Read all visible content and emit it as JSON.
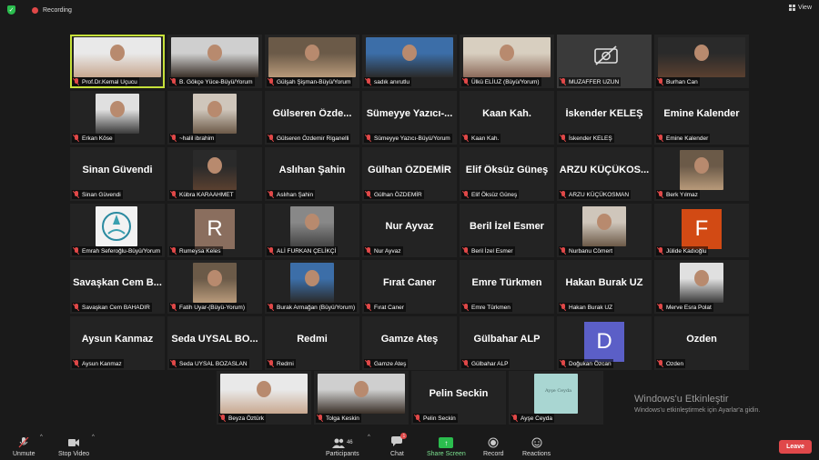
{
  "app": {
    "recording_label": "Recording",
    "view_label": "View"
  },
  "colors": {
    "active_border": "#c6e03a",
    "mute_red": "#e04848",
    "share_green": "#2bbd4e",
    "leave_red": "#e0484a"
  },
  "participants": [
    {
      "label": "Prof.Dr.Kemal Uçucu",
      "display": "",
      "type": "photo",
      "active": true
    },
    {
      "label": "B. Gökçe Yüce-Büyü/Yorum",
      "display": "",
      "type": "photo"
    },
    {
      "label": "Gülşah Şişman-Büyü/Yorum",
      "display": "",
      "type": "photo"
    },
    {
      "label": "sadık anırutlu",
      "display": "",
      "type": "photo"
    },
    {
      "label": "Ülkü ELİUZ (Büyü/Yorum)",
      "display": "",
      "type": "photo"
    },
    {
      "label": "MUZAFFER UZUN",
      "display": "",
      "type": "camoff"
    },
    {
      "label": "Burhan Can",
      "display": "",
      "type": "photo"
    },
    {
      "label": "Erkan Köse",
      "display": "",
      "type": "photo"
    },
    {
      "label": "~halil ibrahim",
      "display": "",
      "type": "photo"
    },
    {
      "label": "Gülseren Özdemir Riganelli",
      "display": "Gülseren Özde...",
      "type": "name"
    },
    {
      "label": "Sümeyye Yazıcı-Büyü/Yorum",
      "display": "Sümeyye Yazıcı-...",
      "type": "name"
    },
    {
      "label": "Kaan Kah.",
      "display": "Kaan Kah.",
      "type": "name"
    },
    {
      "label": "İskender KELEŞ",
      "display": "İskender KELEŞ",
      "type": "name"
    },
    {
      "label": "Emine Kalender",
      "display": "Emine Kalender",
      "type": "name"
    },
    {
      "label": "Sinan Güvendi",
      "display": "Sinan Güvendi",
      "type": "name"
    },
    {
      "label": "Kübra KARAAHMET",
      "display": "",
      "type": "photo"
    },
    {
      "label": "Aslıhan Şahin",
      "display": "Aslıhan Şahin",
      "type": "name"
    },
    {
      "label": "Gülhan ÖZDEMİR",
      "display": "Gülhan ÖZDEMİR",
      "type": "name"
    },
    {
      "label": "Elif Öksüz Güneş",
      "display": "Elif Öksüz Güneş",
      "type": "name"
    },
    {
      "label": "ARZU KÜÇÜKOSMAN",
      "display": "ARZU KÜÇÜKOS...",
      "type": "name"
    },
    {
      "label": "Berk Yılmaz",
      "display": "",
      "type": "photo"
    },
    {
      "label": "Emrah Seferoğlu-Büyü/Yorum",
      "display": "",
      "type": "logo"
    },
    {
      "label": "Rumeysa Keles",
      "display": "R",
      "type": "letter",
      "color": "#8a6e5e"
    },
    {
      "label": "ALİ FURKAN ÇELİKÇİ",
      "display": "",
      "type": "photo"
    },
    {
      "label": "Nur Ayvaz",
      "display": "Nur Ayvaz",
      "type": "name"
    },
    {
      "label": "Beril İzel Esmer",
      "display": "Beril İzel Esmer",
      "type": "name"
    },
    {
      "label": "Nurbanu Cömert",
      "display": "",
      "type": "photo"
    },
    {
      "label": "Jülide Kadıoğlu",
      "display": "F",
      "type": "letter",
      "color": "#d24a14"
    },
    {
      "label": "Savaşkan Cem BAHADIR",
      "display": "Savaşkan Cem B...",
      "type": "name"
    },
    {
      "label": "Fatih Uyar-(Büyü-Yorum)",
      "display": "",
      "type": "photo"
    },
    {
      "label": "Burak Armağan (Büyü/Yorum)",
      "display": "",
      "type": "photo"
    },
    {
      "label": "Fırat Caner",
      "display": "Fırat Caner",
      "type": "name"
    },
    {
      "label": "Emre Türkmen",
      "display": "Emre Türkmen",
      "type": "name"
    },
    {
      "label": "Hakan Burak UZ",
      "display": "Hakan Burak UZ",
      "type": "name"
    },
    {
      "label": "Merve Esra Polat",
      "display": "",
      "type": "photo"
    },
    {
      "label": "Aysun Kanmaz",
      "display": "Aysun Kanmaz",
      "type": "name"
    },
    {
      "label": "Seda UYSAL BOZASLAN",
      "display": "Seda UYSAL BO...",
      "type": "name"
    },
    {
      "label": "Redmi",
      "display": "Redmi",
      "type": "name"
    },
    {
      "label": "Gamze Ateş",
      "display": "Gamze Ateş",
      "type": "name"
    },
    {
      "label": "Gülbahar ALP",
      "display": "Gülbahar ALP",
      "type": "name"
    },
    {
      "label": "Doğukan Özcan",
      "display": "D",
      "type": "letter",
      "color": "#5b5fc7"
    },
    {
      "label": "Ozden",
      "display": "Ozden",
      "type": "name"
    }
  ],
  "last_row": [
    {
      "label": "Beyza Öztürk",
      "display": "",
      "type": "photo"
    },
    {
      "label": "Tolga Keskin",
      "display": "",
      "type": "photo"
    },
    {
      "label": "Pelin Seckin",
      "display": "Pelin Seckin",
      "type": "name"
    },
    {
      "label": "Ayşe Ceyda",
      "display": "",
      "type": "logo2",
      "logo_text": "Ayşe Ceyda"
    }
  ],
  "watermark": {
    "line1": "Windows'u Etkinleştir",
    "line2": "Windows'u etkinleştirmek için Ayarlar'a gidin."
  },
  "toolbar": {
    "unmute": "Unmute",
    "stop_video": "Stop Video",
    "participants": "Participants",
    "participants_count": "46",
    "chat": "Chat",
    "chat_badge": "1",
    "share_screen": "Share Screen",
    "record": "Record",
    "reactions": "Reactions",
    "leave": "Leave"
  }
}
